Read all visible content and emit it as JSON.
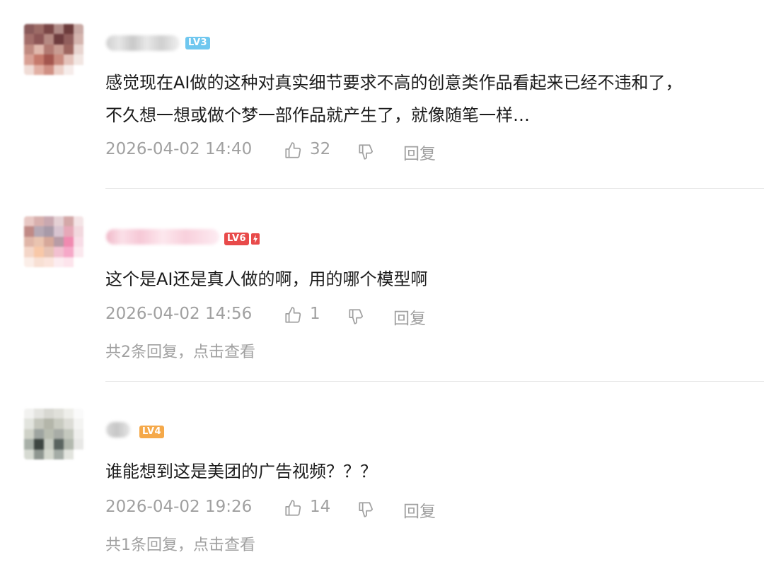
{
  "comments": [
    {
      "level": "LV3",
      "level_color": "#6fc7ef",
      "text_lines": [
        "感觉现在AI做的这种对真实细节要求不高的创意类作品看起来已经不违和了，",
        "不久想一想或做个梦一部作品就产生了，就像随笔一样…"
      ],
      "time": "2026-04-02 14:40",
      "likes": "32",
      "reply_label": "回复"
    },
    {
      "level": "LV6",
      "level_color": "#e84a4a",
      "text_lines": [
        "这个是AI还是真人做的啊，用的哪个模型啊"
      ],
      "time": "2026-04-02 14:56",
      "likes": "1",
      "reply_label": "回复",
      "more_replies": "共2条回复，点击查看"
    },
    {
      "level": "LV4",
      "level_color": "#f5a94a",
      "text_lines": [
        "谁能想到这是美团的广告视频？？？"
      ],
      "time": "2026-04-02 19:26",
      "likes": "14",
      "reply_label": "回复",
      "more_replies": "共1条回复，点击查看"
    }
  ],
  "icons": {
    "like": "thumbs-up-icon",
    "dislike": "thumbs-down-icon"
  },
  "colors": {
    "meta_text": "#a0a0a0",
    "body_text": "#1c1c1c",
    "divider": "#e6e6e6"
  }
}
